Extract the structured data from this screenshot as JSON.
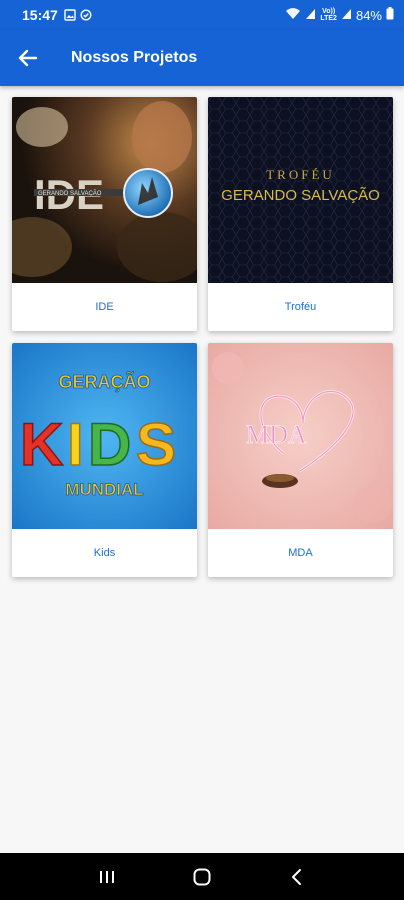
{
  "status_bar": {
    "time": "15:47",
    "battery": "84%",
    "network_line1": "Vo))",
    "network_line2": "LTE2",
    "left_icons": [
      "image-icon",
      "check-circle-icon"
    ],
    "right_icons": [
      "wifi-icon",
      "signal-icon",
      "signal-icon",
      "battery-icon"
    ]
  },
  "app_bar": {
    "title": "Nossos Projetos",
    "back_icon": "arrow-left-icon",
    "color": "#1663d6"
  },
  "projects": [
    {
      "label": "IDE",
      "image": {
        "word": "IDE",
        "tagline": "GERANDO SALVAÇÃO"
      }
    },
    {
      "label": "Troféu",
      "image": {
        "line1": "TROFÉU",
        "line2": "GERANDO SALVAÇÃO"
      }
    },
    {
      "label": "Kids",
      "image": {
        "top": "GERAÇÃO",
        "word": "KIDS",
        "bottom": "MUNDIAL"
      }
    },
    {
      "label": "MDA",
      "image": {
        "word": "MDA"
      }
    }
  ],
  "nav_bar": {
    "icons": [
      "recent-apps-icon",
      "home-icon",
      "back-icon"
    ]
  }
}
